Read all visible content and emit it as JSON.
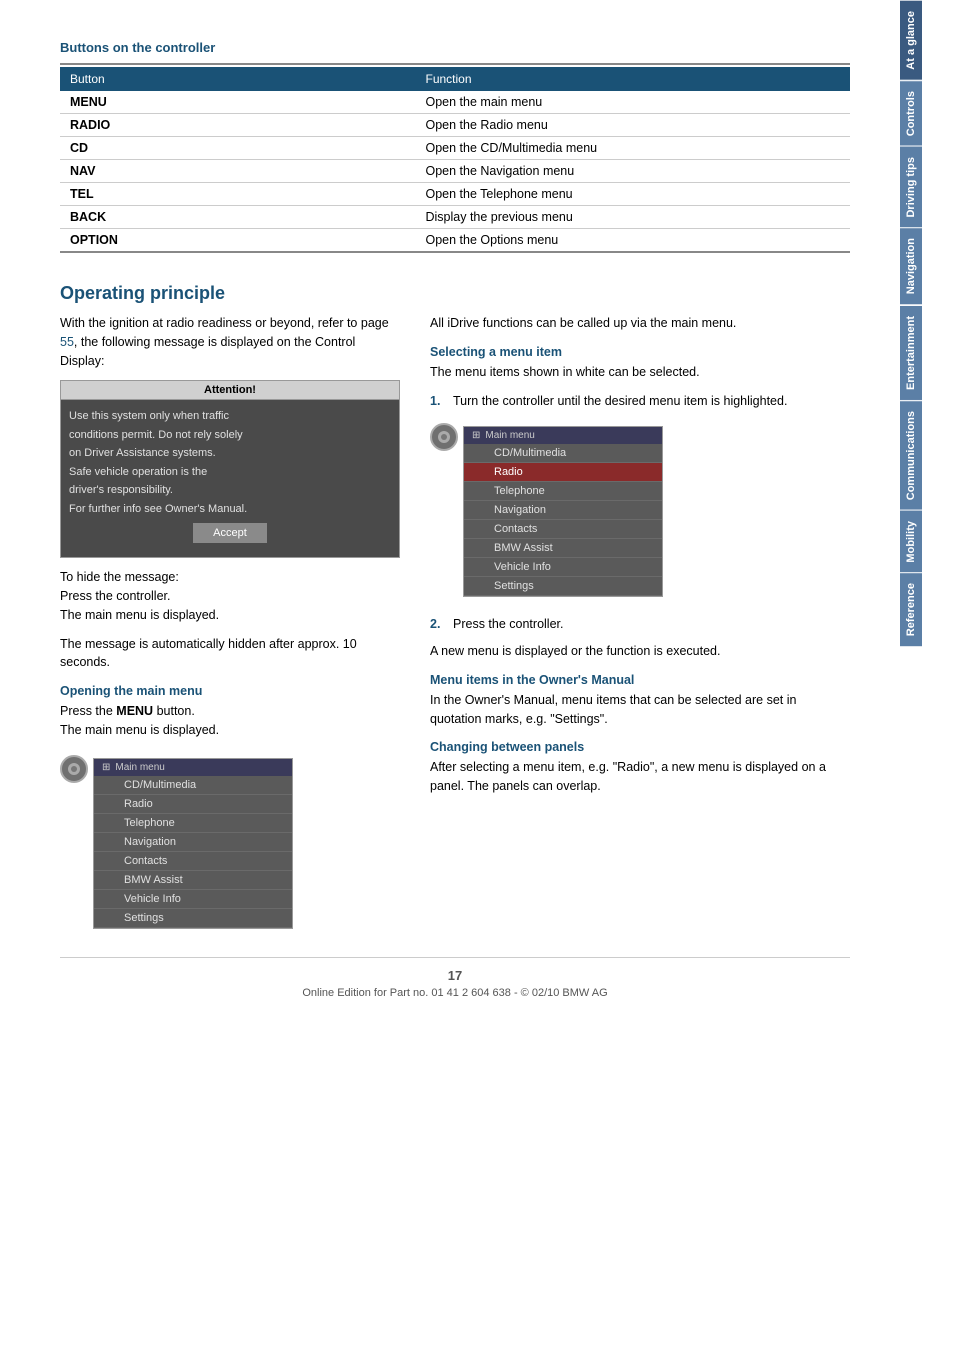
{
  "page": {
    "number": "17",
    "footer_text": "Online Edition for Part no. 01 41 2 604 638 - © 02/10 BMW AG"
  },
  "sidebar": {
    "tabs": [
      {
        "label": "At a glance",
        "active": true
      },
      {
        "label": "Controls",
        "active": false
      },
      {
        "label": "Driving tips",
        "active": false
      },
      {
        "label": "Navigation",
        "active": false
      },
      {
        "label": "Entertainment",
        "active": false
      },
      {
        "label": "Communications",
        "active": false
      },
      {
        "label": "Mobility",
        "active": false
      },
      {
        "label": "Reference",
        "active": false
      }
    ]
  },
  "buttons_section": {
    "title": "Buttons on the controller",
    "table": {
      "col1_header": "Button",
      "col2_header": "Function",
      "rows": [
        {
          "button": "MENU",
          "function": "Open the main menu"
        },
        {
          "button": "RADIO",
          "function": "Open the Radio menu"
        },
        {
          "button": "CD",
          "function": "Open the CD/Multimedia menu"
        },
        {
          "button": "NAV",
          "function": "Open the Navigation menu"
        },
        {
          "button": "TEL",
          "function": "Open the Telephone menu"
        },
        {
          "button": "BACK",
          "function": "Display the previous menu"
        },
        {
          "button": "OPTION",
          "function": "Open the Options menu"
        }
      ]
    }
  },
  "operating_section": {
    "title": "Operating principle",
    "intro_text": "With the ignition at radio readiness or beyond, refer to page ",
    "page_ref": "55",
    "intro_text2": ", the following message is displayed on the Control Display:",
    "attention_box": {
      "header": "Attention!",
      "lines": [
        "Use this system only when traffic",
        "conditions permit. Do not rely solely",
        "on Driver Assistance systems.",
        "Safe vehicle operation is the",
        "driver's responsibility.",
        "For further info see Owner's Manual."
      ],
      "accept_button": "Accept"
    },
    "hide_message_text": "To hide the message:\nPress the controller.\nThe main menu is displayed.",
    "auto_hide_text": "The message is automatically hidden after approx. 10 seconds.",
    "opening_main_menu": {
      "title": "Opening the main menu",
      "text1": "Press the ",
      "bold_word": "MENU",
      "text2": " button.\nThe main menu is displayed."
    },
    "main_menu_items_left": [
      "CD/Multimedia",
      "Radio",
      "Telephone",
      "Navigation",
      "Contacts",
      "BMW Assist",
      "Vehicle Info",
      "Settings"
    ],
    "right_column": {
      "all_functions_text": "All iDrive functions can be called up via the main menu.",
      "selecting_menu_item": {
        "title": "Selecting a menu item",
        "text": "The menu items shown in white can be selected."
      },
      "step1": "Turn the controller until the desired menu item is highlighted.",
      "main_menu_items_right": [
        {
          "label": "CD/Multimedia",
          "highlighted": false
        },
        {
          "label": "Radio",
          "highlighted": true
        },
        {
          "label": "Telephone",
          "highlighted": false
        },
        {
          "label": "Navigation",
          "highlighted": false
        },
        {
          "label": "Contacts",
          "highlighted": false
        },
        {
          "label": "BMW Assist",
          "highlighted": false
        },
        {
          "label": "Vehicle Info",
          "highlighted": false
        },
        {
          "label": "Settings",
          "highlighted": false
        }
      ],
      "step2": "Press the controller.",
      "step2_result": "A new menu is displayed or the function is executed.",
      "owners_manual_section": {
        "title": "Menu items in the Owner's Manual",
        "text": "In the Owner's Manual, menu items that can be selected are set in quotation marks, e.g. \"Settings\"."
      },
      "changing_panels_section": {
        "title": "Changing between panels",
        "text": "After selecting a menu item, e.g. \"Radio\", a new menu is displayed on a panel. The panels can overlap."
      }
    }
  }
}
